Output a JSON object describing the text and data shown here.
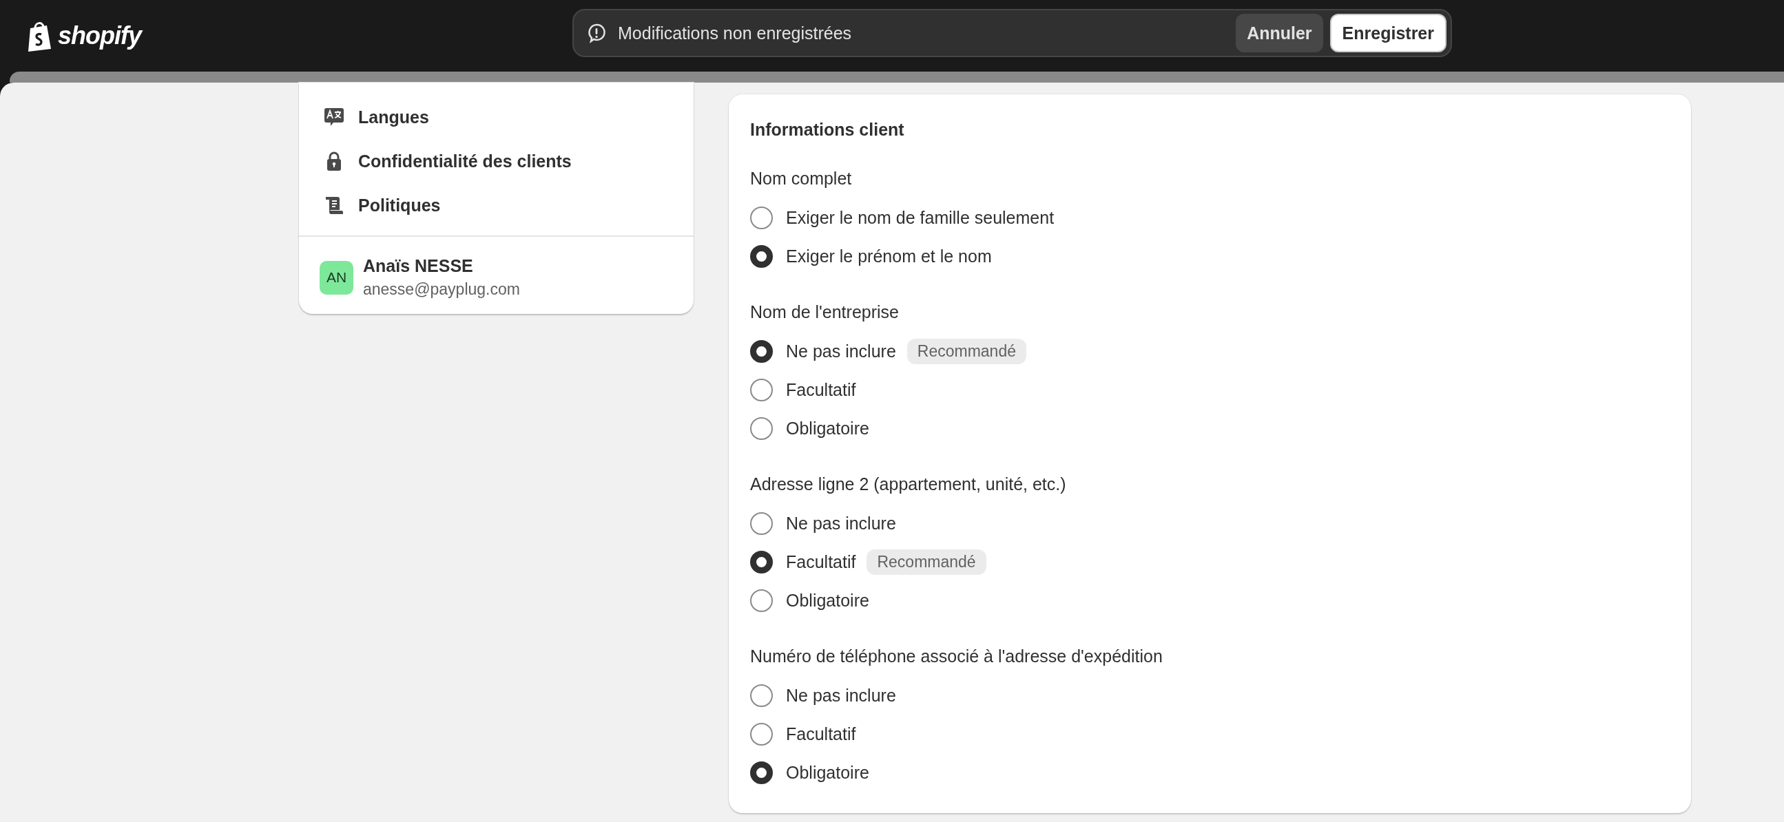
{
  "top_bar": {
    "logo": "shopify",
    "notice": "Modifications non enregistrées",
    "buttons": [
      {
        "label": "Annuler",
        "kind": "secondary"
      },
      {
        "label": "Enregistrer",
        "kind": "primary"
      }
    ]
  },
  "sidebar": {
    "items": [
      {
        "label": "Langues",
        "kind": "languages"
      },
      {
        "label": "Confidentialité des clients",
        "kind": "privacy"
      },
      {
        "label": "Politiques",
        "kind": "policies"
      }
    ],
    "user": {
      "initials": "AN",
      "name": "Anaïs NESSE",
      "email": "anesse@payplug.com"
    }
  },
  "card": {
    "title": "Informations client",
    "groups": [
      {
        "label": "Nom complet",
        "options": [
          {
            "label": "Exiger le nom de famille seulement",
            "selected": false
          },
          {
            "label": "Exiger le prénom et le nom",
            "selected": true
          }
        ]
      },
      {
        "label": "Nom de l'entreprise",
        "options": [
          {
            "label": "Ne pas inclure",
            "selected": true,
            "badge": "Recommandé"
          },
          {
            "label": "Facultatif",
            "selected": false
          },
          {
            "label": "Obligatoire",
            "selected": false
          }
        ]
      },
      {
        "label": "Adresse ligne 2 (appartement, unité, etc.)",
        "options": [
          {
            "label": "Ne pas inclure",
            "selected": false
          },
          {
            "label": "Facultatif",
            "selected": true,
            "badge": "Recommandé"
          },
          {
            "label": "Obligatoire",
            "selected": false
          }
        ]
      },
      {
        "label": "Numéro de téléphone associé à l'adresse d'expédition",
        "options": [
          {
            "label": "Ne pas inclure",
            "selected": false
          },
          {
            "label": "Facultatif",
            "selected": false
          },
          {
            "label": "Obligatoire",
            "selected": true
          }
        ]
      }
    ]
  }
}
